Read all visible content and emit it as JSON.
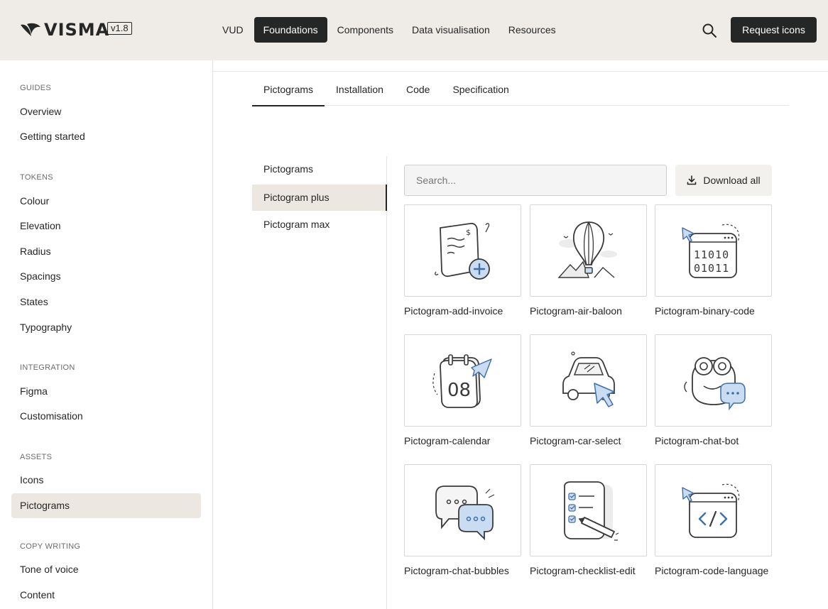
{
  "header": {
    "brand": "VISMA",
    "version": "v1.8",
    "nav": [
      "VUD",
      "Foundations",
      "Components",
      "Data visualisation",
      "Resources"
    ],
    "active_nav": "Foundations",
    "request_label": "Request icons",
    "icons": {
      "search": "search-icon"
    }
  },
  "sidebar": {
    "sections": [
      {
        "heading": "GUIDES",
        "items": [
          "Overview",
          "Getting started"
        ]
      },
      {
        "heading": "TOKENS",
        "items": [
          "Colour",
          "Elevation",
          "Radius",
          "Spacings",
          "States",
          "Typography"
        ]
      },
      {
        "heading": "INTEGRATION",
        "items": [
          "Figma",
          "Customisation"
        ]
      },
      {
        "heading": "ASSETS",
        "items": [
          "Icons",
          "Pictograms"
        ]
      },
      {
        "heading": "COPY WRITING",
        "items": [
          "Tone of voice",
          "Content"
        ]
      }
    ],
    "active_item": "Pictograms"
  },
  "tabs": [
    "Pictograms",
    "Installation",
    "Code",
    "Specification"
  ],
  "active_tab": "Pictograms",
  "subnav": [
    "Pictograms",
    "Pictogram plus",
    "Pictogram max"
  ],
  "active_subnav": "Pictogram plus",
  "search": {
    "placeholder": "Search...",
    "value": ""
  },
  "download_label": "Download all",
  "pictograms": [
    {
      "label": "Pictogram-add-invoice",
      "icon": "add-invoice-icon"
    },
    {
      "label": "Pictogram-air-baloon",
      "icon": "air-balloon-icon"
    },
    {
      "label": "Pictogram-binary-code",
      "icon": "binary-code-icon"
    },
    {
      "label": "Pictogram-calendar",
      "icon": "calendar-icon"
    },
    {
      "label": "Pictogram-car-select",
      "icon": "car-select-icon"
    },
    {
      "label": "Pictogram-chat-bot",
      "icon": "chat-bot-icon"
    },
    {
      "label": "Pictogram-chat-bubbles",
      "icon": "chat-bubbles-icon"
    },
    {
      "label": "Pictogram-checklist-edit",
      "icon": "checklist-edit-icon"
    },
    {
      "label": "Pictogram-code-language",
      "icon": "code-language-icon"
    }
  ],
  "colors": {
    "accent_blue": "#c9dcf2",
    "accent_stroke": "#3f6fa8",
    "dark": "#252626",
    "beige": "#efebe6"
  }
}
